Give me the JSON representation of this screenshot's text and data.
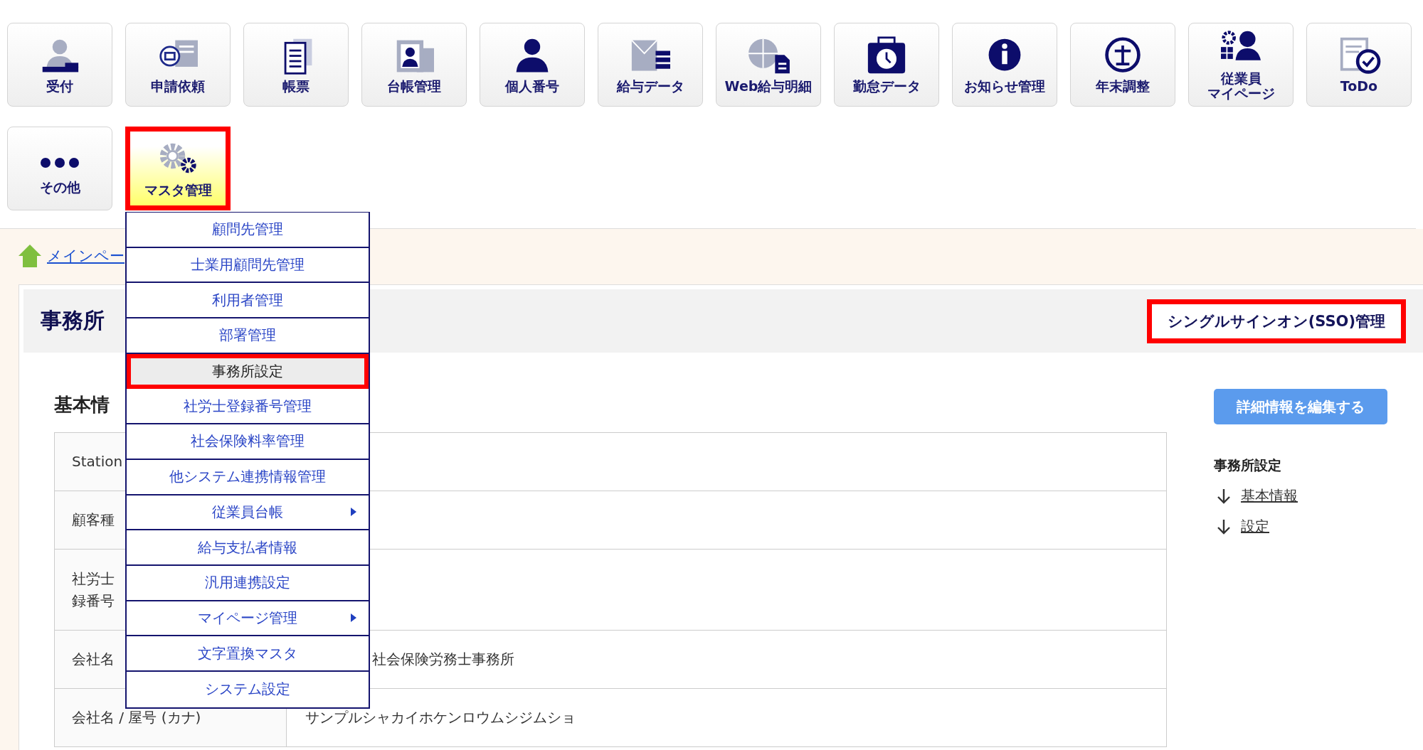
{
  "toolbar": [
    {
      "label": "受付",
      "selected": false,
      "highlighted": false
    },
    {
      "label": "申請依頼",
      "selected": false,
      "highlighted": false
    },
    {
      "label": "帳票",
      "selected": false,
      "highlighted": false
    },
    {
      "label": "台帳管理",
      "selected": false,
      "highlighted": false
    },
    {
      "label": "個人番号",
      "selected": false,
      "highlighted": false
    },
    {
      "label": "給与データ",
      "selected": false,
      "highlighted": false
    },
    {
      "label": "Web給与明細",
      "selected": false,
      "highlighted": false
    },
    {
      "label": "勤怠データ",
      "selected": false,
      "highlighted": false
    },
    {
      "label": "お知らせ管理",
      "selected": false,
      "highlighted": false
    },
    {
      "label": "年末調整",
      "selected": false,
      "highlighted": false
    },
    {
      "label_lines": [
        "従業員",
        "マイページ"
      ],
      "selected": false,
      "highlighted": false
    },
    {
      "label": "ToDo",
      "selected": false,
      "highlighted": false
    },
    {
      "label": "その他",
      "selected": false,
      "highlighted": false
    },
    {
      "label": "マスタ管理",
      "selected": true,
      "highlighted": true
    }
  ],
  "breadcrumb": {
    "label": "メインペー"
  },
  "menu": {
    "items": [
      {
        "label": "顧問先管理",
        "selected": false,
        "highlighted": false,
        "has_submenu": false
      },
      {
        "label": "士業用顧問先管理",
        "selected": false,
        "highlighted": false,
        "has_submenu": false
      },
      {
        "label": "利用者管理",
        "selected": false,
        "highlighted": false,
        "has_submenu": false
      },
      {
        "label": "部署管理",
        "selected": false,
        "highlighted": false,
        "has_submenu": false
      },
      {
        "label": "事務所設定",
        "selected": true,
        "highlighted": true,
        "has_submenu": false
      },
      {
        "label": "社労士登録番号管理",
        "selected": false,
        "highlighted": false,
        "has_submenu": false
      },
      {
        "label": "社会保険料率管理",
        "selected": false,
        "highlighted": false,
        "has_submenu": false
      },
      {
        "label": "他システム連携情報管理",
        "selected": false,
        "highlighted": false,
        "has_submenu": false
      },
      {
        "label": "従業員台帳",
        "selected": false,
        "highlighted": false,
        "has_submenu": true
      },
      {
        "label": "給与支払者情報",
        "selected": false,
        "highlighted": false,
        "has_submenu": false
      },
      {
        "label": "汎用連携設定",
        "selected": false,
        "highlighted": false,
        "has_submenu": false
      },
      {
        "label": "マイページ管理",
        "selected": false,
        "highlighted": false,
        "has_submenu": true
      },
      {
        "label": "文字置換マスタ",
        "selected": false,
        "highlighted": false,
        "has_submenu": false
      },
      {
        "label": "システム設定",
        "selected": false,
        "highlighted": false,
        "has_submenu": false
      }
    ]
  },
  "page": {
    "title": "事務所",
    "sso_button": {
      "label": "シングルサインオン(SSO)管理",
      "highlighted": true
    },
    "section_title": "基本情",
    "edit_button": {
      "label": "詳細情報を編集する"
    },
    "table": {
      "rows": [
        {
          "label": "Station"
        },
        {
          "label": "顧客種"
        },
        {
          "label_lines": [
            "社労士",
            "録番号"
          ]
        },
        {
          "label": "会社名",
          "value": "社会保険労務士事務所"
        },
        {
          "label": "会社名 / 屋号 (カナ)",
          "value": "サンプルシャカイホケンロウムシジムショ"
        }
      ]
    },
    "side_nav": {
      "title": "事務所設定",
      "links": [
        "基本情報",
        "設定"
      ]
    }
  }
}
